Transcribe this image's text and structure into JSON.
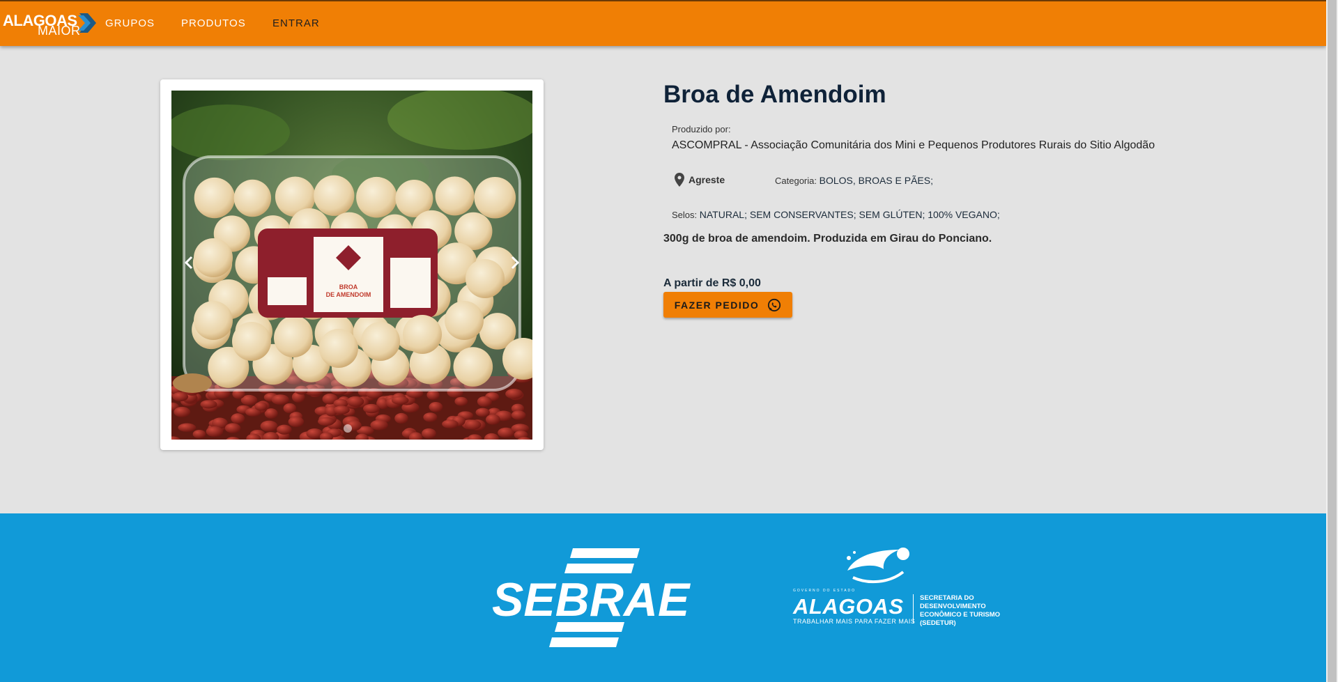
{
  "header": {
    "logo_top": "ALAGOAS",
    "logo_bottom": "MAIOR",
    "nav": [
      "GRUPOS",
      "PRODUTOS",
      "ENTRAR"
    ]
  },
  "product": {
    "title": "Broa de Amendoim",
    "produced_by_label": "Produzido por:",
    "producer": "ASCOMPRAL - Associação Comunitária dos Mini e Pequenos Produtores Rurais do Sitio Algodão",
    "region": "Agreste",
    "category_label": "Categoria:",
    "category_value": "BOLOS, BROAS E PÃES;",
    "seals_label": "Selos:",
    "seals_value": "NATURAL; SEM CONSERVANTES; SEM GLÚTEN; 100% VEGANO;",
    "description": "300g de broa de amendoim. Produzida em Girau do Ponciano.",
    "price": "A partir de R$ 0,00",
    "order_button": "FAZER PEDIDO"
  },
  "image": {
    "package_label_line1": "BROA",
    "package_label_line2": "DE AMENDOIM",
    "carousel_active_index": 0,
    "carousel_count": 1
  },
  "footer": {
    "sebrae_logo": "SEBRAE",
    "gov_small": "GOVERNO DO ESTADO",
    "alagoas_word": "ALAGOAS",
    "alagoas_tagline": "TRABALHAR MAIS PARA FAZER MAIS",
    "secretaria_lines": [
      "SECRETARIA DO",
      "DESENVOLVIMENTO",
      "ECONÔMICO E TURISMO",
      "(SEDETUR)"
    ]
  },
  "colors": {
    "header": "#f07f05",
    "background": "#e3e3e3",
    "footer": "#119ad8",
    "title": "#0f2238"
  },
  "icons": {
    "logo_chevron": "chevron-right-icon",
    "carousel_prev": "chevron-left-icon",
    "carousel_next": "chevron-right-icon",
    "region": "map-pin-icon",
    "order": "whatsapp-icon"
  }
}
